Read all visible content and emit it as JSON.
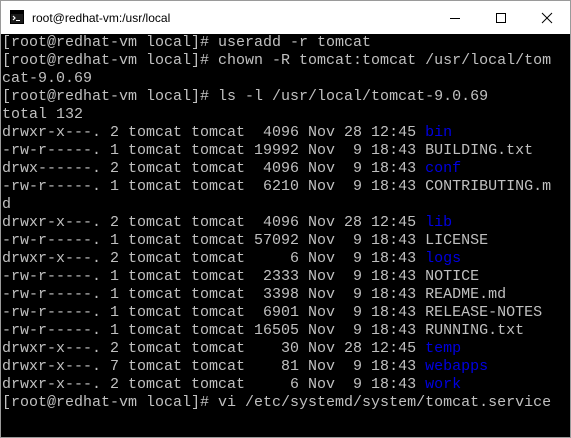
{
  "window": {
    "title": "root@redhat-vm:/usr/local",
    "app_icon": "console-icon",
    "controls": [
      "minimize-icon",
      "maximize-icon",
      "close-icon"
    ]
  },
  "terminal": {
    "lines": [
      {
        "text": "[root@redhat-vm local]# useradd -r tomcat"
      },
      {
        "text": "[root@redhat-vm local]# chown -R tomcat:tomcat /usr/local/tom"
      },
      {
        "text": "cat-9.0.69"
      },
      {
        "text": "[root@redhat-vm local]# ls -l /usr/local/tomcat-9.0.69"
      },
      {
        "text": "total 132"
      },
      {
        "text": "drwxr-x---. 2 tomcat tomcat  4096 Nov 28 12:45 ",
        "name": "bin",
        "is_dir": true
      },
      {
        "text": "-rw-r-----. 1 tomcat tomcat 19992 Nov  9 18:43 ",
        "name": "BUILDING.txt",
        "is_dir": false
      },
      {
        "text": "drwx------. 2 tomcat tomcat  4096 Nov  9 18:43 ",
        "name": "conf",
        "is_dir": true
      },
      {
        "text": "-rw-r-----. 1 tomcat tomcat  6210 Nov  9 18:43 ",
        "name": "CONTRIBUTING.m",
        "is_dir": false
      },
      {
        "text": "d"
      },
      {
        "text": "drwxr-x---. 2 tomcat tomcat  4096 Nov 28 12:45 ",
        "name": "lib",
        "is_dir": true
      },
      {
        "text": "-rw-r-----. 1 tomcat tomcat 57092 Nov  9 18:43 ",
        "name": "LICENSE",
        "is_dir": false
      },
      {
        "text": "drwxr-x---. 2 tomcat tomcat     6 Nov  9 18:43 ",
        "name": "logs",
        "is_dir": true
      },
      {
        "text": "-rw-r-----. 1 tomcat tomcat  2333 Nov  9 18:43 ",
        "name": "NOTICE",
        "is_dir": false
      },
      {
        "text": "-rw-r-----. 1 tomcat tomcat  3398 Nov  9 18:43 ",
        "name": "README.md",
        "is_dir": false
      },
      {
        "text": "-rw-r-----. 1 tomcat tomcat  6901 Nov  9 18:43 ",
        "name": "RELEASE-NOTES",
        "is_dir": false
      },
      {
        "text": "-rw-r-----. 1 tomcat tomcat 16505 Nov  9 18:43 ",
        "name": "RUNNING.txt",
        "is_dir": false
      },
      {
        "text": "drwxr-x---. 2 tomcat tomcat    30 Nov 28 12:45 ",
        "name": "temp",
        "is_dir": true
      },
      {
        "text": "drwxr-x---. 7 tomcat tomcat    81 Nov  9 18:43 ",
        "name": "webapps",
        "is_dir": true
      },
      {
        "text": "drwxr-x---. 2 tomcat tomcat     6 Nov  9 18:43 ",
        "name": "work",
        "is_dir": true
      },
      {
        "text": "[root@redhat-vm local]# vi /etc/systemd/system/tomcat.service"
      }
    ]
  },
  "colors": {
    "terminal_background": "#000000",
    "terminal_text": "#c0c0c0",
    "directory": "#0000e0"
  }
}
